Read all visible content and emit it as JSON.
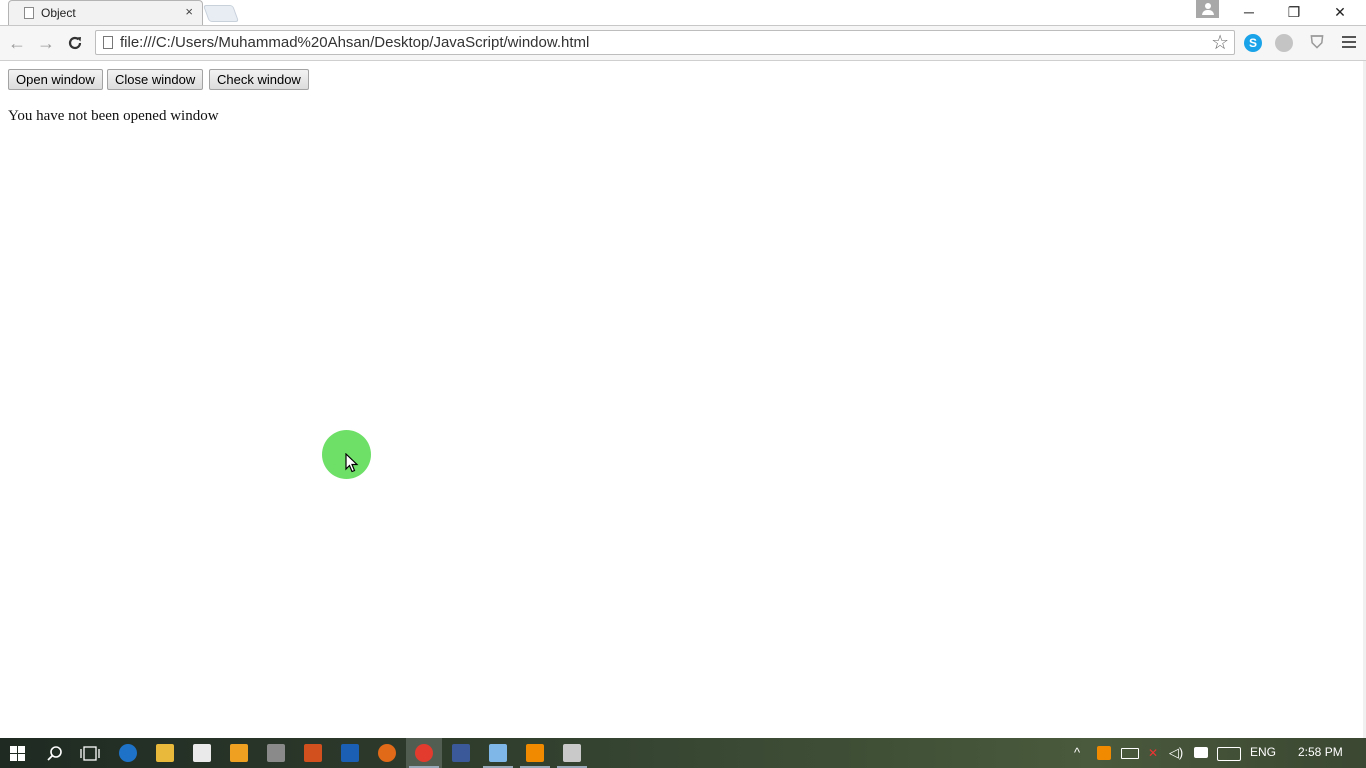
{
  "browser": {
    "tab": {
      "title": "Object",
      "close_glyph": "×"
    },
    "window_controls": {
      "minimize": "─",
      "restore": "❐",
      "close": "✕"
    },
    "nav": {
      "back_glyph": "←",
      "forward_glyph": "→",
      "reload_glyph": "C"
    },
    "address_bar": {
      "url": "file:///C:/Users/Muhammad%20Ahsan/Desktop/JavaScript/window.html",
      "bookmark_glyph": "☆"
    },
    "extensions": [
      {
        "name": "skype-icon",
        "glyph": "S"
      },
      {
        "name": "ghostery-icon",
        "glyph": "●"
      },
      {
        "name": "shield-icon",
        "glyph": "⛉"
      }
    ]
  },
  "page": {
    "buttons": {
      "open": "Open window",
      "close": "Close window",
      "check": "Check window"
    },
    "status_text": "You have not been opened window"
  },
  "taskbar": {
    "start_glyph": "⊞",
    "search_glyph": "⌕",
    "tray": {
      "chevron": "^",
      "language": "ENG",
      "time": "2:58 PM"
    }
  },
  "colors": {
    "cursor_highlight": "#6ee068",
    "skype": "#1aa3e8",
    "taskbar": "#2d3a2b"
  }
}
